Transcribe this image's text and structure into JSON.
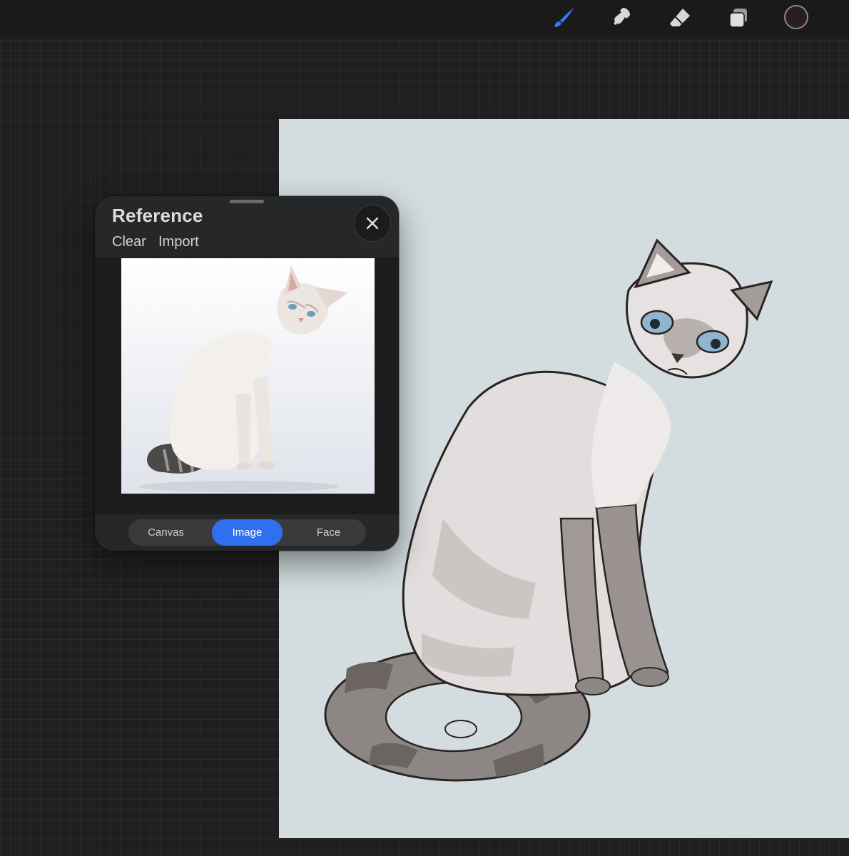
{
  "toolbar": {
    "tools": [
      {
        "name": "brush",
        "icon": "brush-icon",
        "active": true
      },
      {
        "name": "smudge",
        "icon": "smudge-icon",
        "active": false
      },
      {
        "name": "eraser",
        "icon": "eraser-icon",
        "active": false
      },
      {
        "name": "layers",
        "icon": "layers-icon",
        "active": false
      }
    ],
    "color": {
      "icon": "color-well",
      "value": "#2a1f1e"
    },
    "accent": "#2f7cf6"
  },
  "canvas": {
    "background": "#d3dde0",
    "subject": "cat-drawing"
  },
  "reference_panel": {
    "title": "Reference",
    "clear_label": "Clear",
    "import_label": "Import",
    "close_icon": "close-icon",
    "image": "reference-cat-photo",
    "segments": [
      {
        "label": "Canvas",
        "active": false
      },
      {
        "label": "Image",
        "active": true
      },
      {
        "label": "Face",
        "active": false
      }
    ]
  }
}
